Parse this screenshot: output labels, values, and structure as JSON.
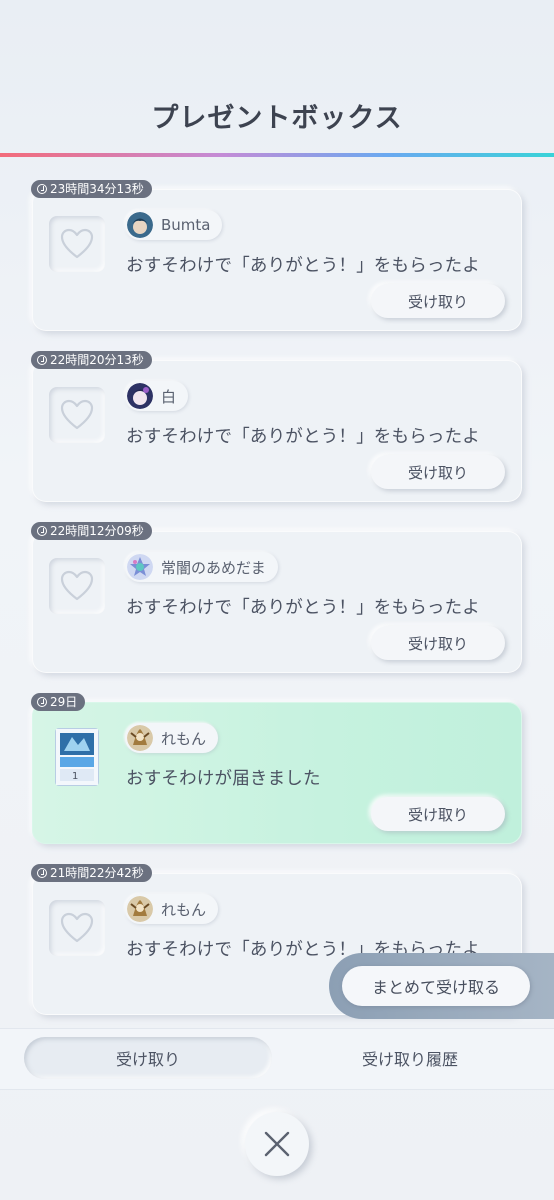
{
  "header": {
    "title": "プレゼントボックス"
  },
  "gifts": [
    {
      "timer": "23時間34分13秒",
      "sender": "Bumta",
      "message": "おすそわけで「ありがとう！」をもらったよ",
      "button": "受け取り",
      "icon": "heart-icon",
      "highlight": false
    },
    {
      "timer": "22時間20分13秒",
      "sender": "白",
      "message": "おすそわけで「ありがとう！」をもらったよ",
      "button": "受け取り",
      "icon": "heart-icon",
      "highlight": false
    },
    {
      "timer": "22時間12分09秒",
      "sender": "常闇のあめだま",
      "message": "おすそわけで「ありがとう！」をもらったよ",
      "button": "受け取り",
      "icon": "heart-icon",
      "highlight": false
    },
    {
      "timer": "29日",
      "sender": "れもん",
      "message": "おすそわけが届きました",
      "button": "受け取り",
      "icon": "card-icon",
      "card_count": "1",
      "highlight": true
    },
    {
      "timer": "21時間22分42秒",
      "sender": "れもん",
      "message": "おすそわけで「ありがとう！」をもらったよ",
      "button": "受け取り",
      "icon": "heart-icon",
      "highlight": false
    }
  ],
  "bulk_claim_label": "まとめて受け取る",
  "tabs": [
    {
      "label": "受け取り",
      "active": true
    },
    {
      "label": "受け取り履歴",
      "active": false
    }
  ],
  "colors": {
    "accent_gradient": [
      "#f36b7a",
      "#c48bd6",
      "#6aa9f0",
      "#39d3d8"
    ],
    "highlight_card": "#c6f2df",
    "timer_badge": "#6b7180"
  }
}
